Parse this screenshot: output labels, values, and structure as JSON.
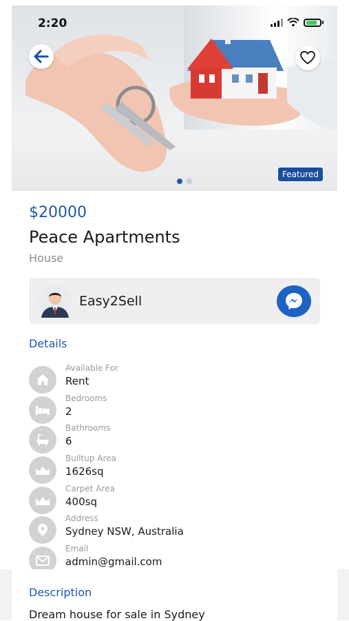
{
  "status_bar": {
    "time": "2:20"
  },
  "listing": {
    "price": "$20000",
    "title": "Peace Apartments",
    "type": "House",
    "featured_badge": "Featured"
  },
  "agent": {
    "name": "Easy2Sell"
  },
  "details": {
    "heading": "Details",
    "items": [
      {
        "label": "Available For",
        "value": "Rent",
        "icon": "home-icon"
      },
      {
        "label": "Bedrooms",
        "value": "2",
        "icon": "bed-icon"
      },
      {
        "label": "Bathrooms",
        "value": "6",
        "icon": "bathtub-icon"
      },
      {
        "label": "Builtup Area",
        "value": "1626sq",
        "icon": "area-icon"
      },
      {
        "label": "Carpet Area",
        "value": "400sq",
        "icon": "area-icon"
      },
      {
        "label": "Address",
        "value": "Sydney NSW, Australia",
        "icon": "location-pin-icon"
      },
      {
        "label": "Email",
        "value": "admin@gmail.com",
        "icon": "mail-icon"
      }
    ]
  },
  "description": {
    "heading": "Description",
    "text": "Dream house for sale in Sydney"
  },
  "colors": {
    "accent": "#1d57a8",
    "badge": "#1a4d9c",
    "messenger": "#1d63c4",
    "icon_bg": "#d2d2d2"
  }
}
